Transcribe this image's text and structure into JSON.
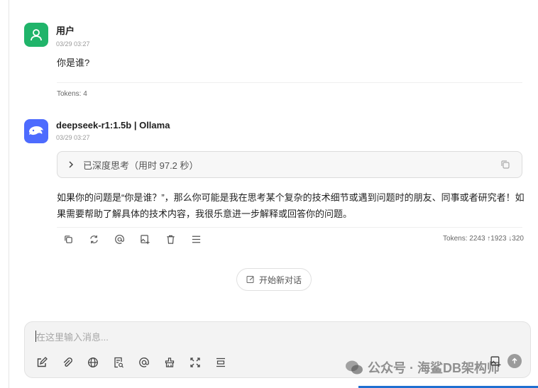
{
  "user_message": {
    "name": "用户",
    "time": "03/29 03:27",
    "text": "你是谁?",
    "tokens": "Tokens: 4",
    "avatar_color": "#20b46a"
  },
  "bot_message": {
    "name": "deepseek-r1:1.5b | Ollama",
    "time": "03/29 03:27",
    "thinking_label": "已深度思考（用时 97.2 秒）",
    "answer": "如果你的问题是“你是谁？”，那么你可能是我在思考某个复杂的技术细节或遇到问题时的朋友、同事或者研究者！如果需要帮助了解具体的技术内容，我很乐意进一步解释或回答你的问题。",
    "tokens": "Tokens: 2243 ↑1923 ↓320",
    "avatar_color": "#4d6bfe",
    "toolbar_icons": [
      "copy-icon",
      "regenerate-icon",
      "mention-icon",
      "image-icon",
      "delete-icon",
      "menu-icon"
    ]
  },
  "new_chat": {
    "label": "开始新对话"
  },
  "composer": {
    "placeholder": "在这里输入消息...",
    "tool_icons": [
      "edit-icon",
      "attach-icon",
      "web-search-icon",
      "knowledge-icon",
      "mention-icon",
      "clear-icon",
      "expand-icon",
      "divider-icon"
    ]
  },
  "watermark": {
    "text": "公众号 · 海鲨DB架构师"
  },
  "colors": {
    "accent": "#4d6bfe",
    "user": "#20b46a",
    "bottom_bar": "#1f6fd1"
  }
}
